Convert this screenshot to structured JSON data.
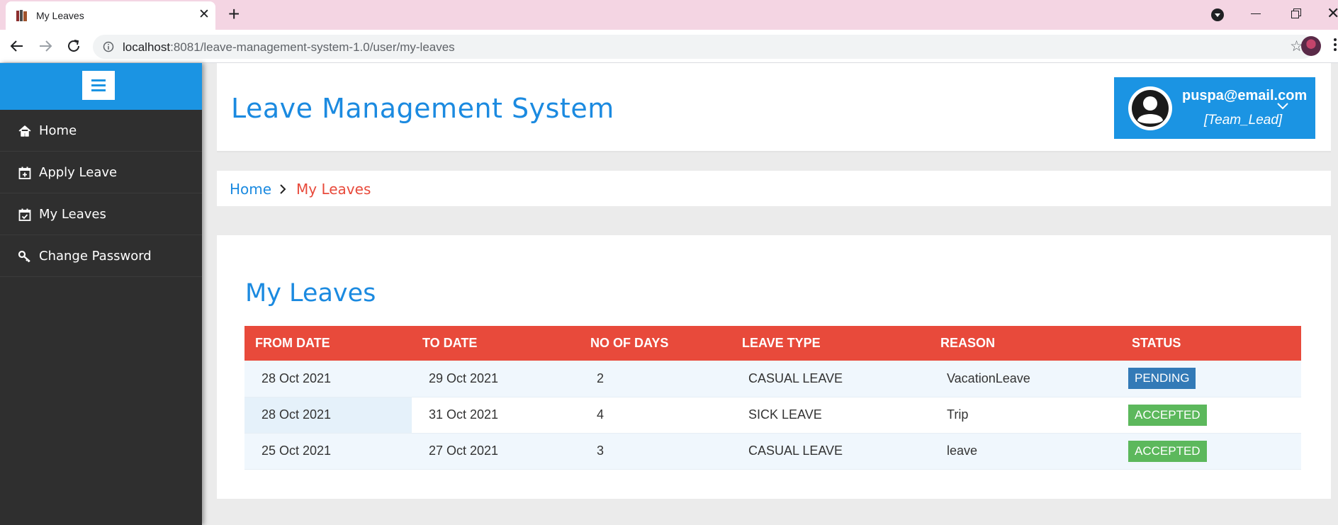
{
  "browser": {
    "tab_title": "My Leaves",
    "url_host": "localhost",
    "url_rest": ":8081/leave-management-system-1.0/user/my-leaves"
  },
  "sidebar": {
    "items": [
      {
        "label": "Home",
        "icon": "home-icon"
      },
      {
        "label": "Apply Leave",
        "icon": "calendar-plus-icon"
      },
      {
        "label": "My Leaves",
        "icon": "calendar-check-icon"
      },
      {
        "label": "Change Password",
        "icon": "key-icon"
      }
    ]
  },
  "header": {
    "title": "Leave Management System",
    "user_email": "puspa@email.com",
    "user_role": "[Team_Lead]"
  },
  "breadcrumb": {
    "home": "Home",
    "current": "My Leaves"
  },
  "main": {
    "title": "My Leaves",
    "columns": [
      "FROM DATE",
      "TO DATE",
      "NO OF DAYS",
      "LEAVE TYPE",
      "REASON",
      "STATUS"
    ],
    "rows": [
      {
        "from": "28 Oct 2021",
        "to": "29 Oct 2021",
        "days": "2",
        "type": "CASUAL LEAVE",
        "reason": "VacationLeave",
        "status": "PENDING"
      },
      {
        "from": "28 Oct 2021",
        "to": "31 Oct 2021",
        "days": "4",
        "type": "SICK LEAVE",
        "reason": "Trip",
        "status": "ACCEPTED"
      },
      {
        "from": "25 Oct 2021",
        "to": "27 Oct 2021",
        "days": "3",
        "type": "CASUAL LEAVE",
        "reason": "leave",
        "status": "ACCEPTED"
      }
    ]
  },
  "colors": {
    "primary": "#1b94e3",
    "danger": "#e84a3b",
    "pending": "#337ab7",
    "accepted": "#5cb85c",
    "sidebar": "#2f2f2f"
  }
}
